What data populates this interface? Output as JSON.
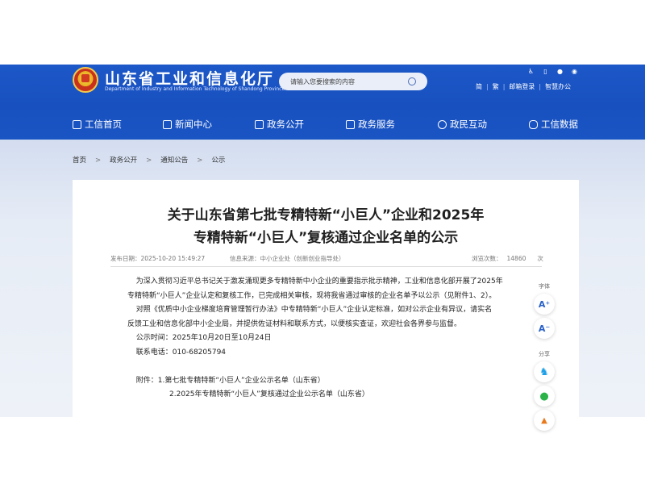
{
  "header": {
    "site_title": "山东省工业和信息化厅",
    "site_subtitle": "Department of Industry and Information Technology of Shandong Province",
    "search_placeholder": "请输入您要搜索的内容",
    "tool_icons": [
      "accessibility-icon",
      "mobile-icon",
      "wechat-icon",
      "weibo-icon"
    ],
    "links": {
      "simplified": "简",
      "traditional": "繁",
      "mail_login": "邮箱登录",
      "smart_office": "智慧办公"
    }
  },
  "nav": {
    "items": [
      {
        "label": "工信首页",
        "icon": "home-icon"
      },
      {
        "label": "新闻中心",
        "icon": "news-icon"
      },
      {
        "label": "政务公开",
        "icon": "monitor-icon"
      },
      {
        "label": "政务服务",
        "icon": "service-icon"
      },
      {
        "label": "政民互动",
        "icon": "chat-icon"
      },
      {
        "label": "工信数据",
        "icon": "database-icon"
      }
    ]
  },
  "breadcrumb": {
    "items": [
      "首页",
      "政务公开",
      "通知公告",
      "公示"
    ],
    "separator": ">"
  },
  "article": {
    "title_line1": "关于山东省第七批专精特新“小巨人”企业和2025年",
    "title_line2": "专精特新“小巨人”复核通过企业名单的公示",
    "meta": {
      "publish_label": "发布日期：",
      "publish_date": "2025-10-20 15:49:27",
      "source_label": "信息来源：",
      "source": "中小企业处（创新创业指导处）",
      "views_label": "浏览次数：",
      "views": "14860",
      "views_unit": "次"
    },
    "p1_line1": "为深入贯彻习近平总书记关于激发涌现更多专精特新中小企业的重要指示批示精神，工业和信息化部开展了2025年",
    "p1_line2": "专精特新“小巨人”企业认定和复核工作，已完成相关审核，现将我省通过审核的企业名单予以公示（见附件1、2）。",
    "p2_line1": "对照《优质中小企业梯度培育管理暂行办法》中专精特新“小巨人”企业认定标准，如对公示企业有异议，请实名",
    "p2_line2": "反馈工业和信息化部中小企业局，并提供佐证材料和联系方式，以便核实查证，欢迎社会各界参与监督。",
    "notice_period": "公示时间：2025年10月20日至10月24日",
    "phone": "联系电话：010-68205794",
    "attachment1": "附件：1.第七批专精特新“小巨人”企业公示名单（山东省）",
    "attachment2": "2.2025年专精特新“小巨人”复核通过企业公示名单（山东省）"
  },
  "sidebar": {
    "font_label": "字体",
    "font_increase": "A⁺",
    "font_decrease": "A⁻",
    "share_label": "分享",
    "share_icons": [
      "qq-icon",
      "wechat-share-icon",
      "weibo-share-icon"
    ]
  },
  "colors": {
    "header_blue": "#1a55c4",
    "title_text": "#1f1f1f",
    "link_blue": "#2a61c8"
  }
}
